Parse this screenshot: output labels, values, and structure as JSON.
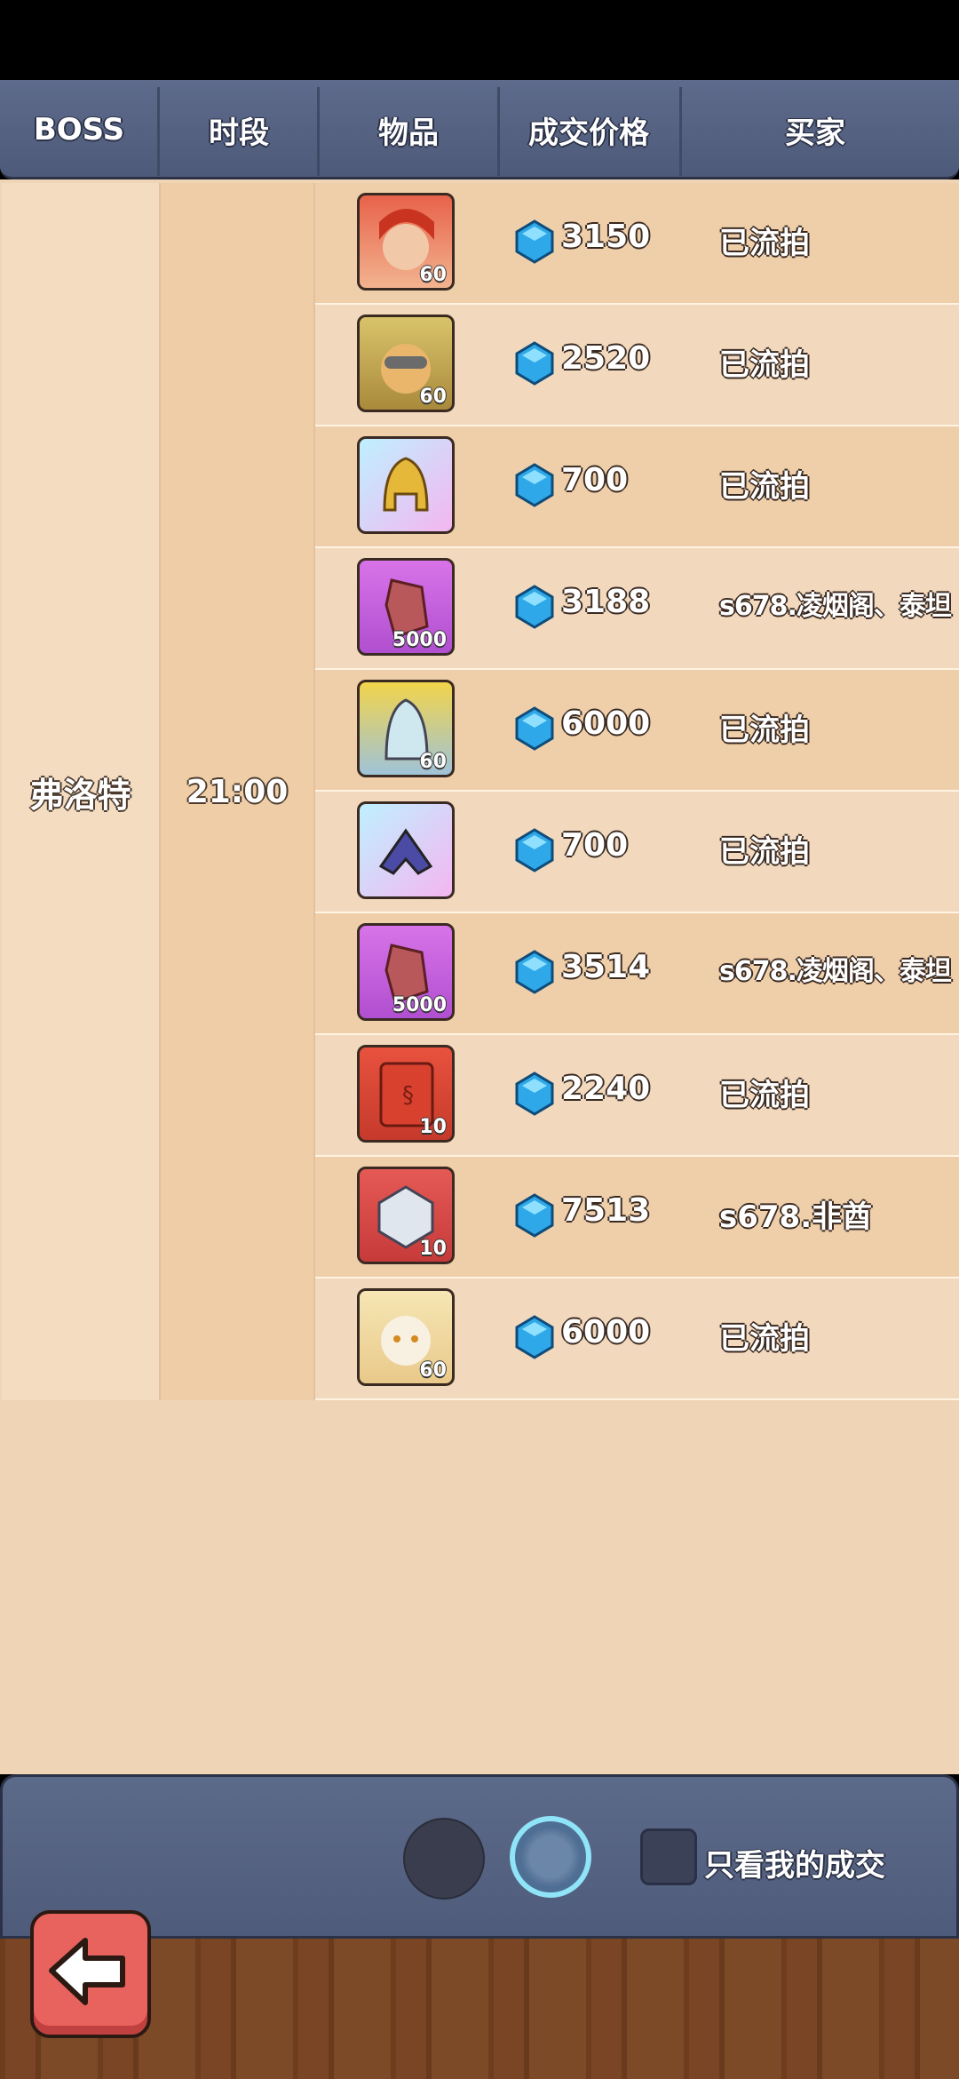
{
  "header": {
    "columns": [
      "BOSS",
      "时段",
      "物品",
      "成交价格",
      "买家"
    ]
  },
  "group": {
    "boss": "弗洛特",
    "time": "21:00"
  },
  "rows": [
    {
      "item": "red-haired-hero-card",
      "level": "60",
      "price": "3150",
      "buyer": "已流拍"
    },
    {
      "item": "goggles-hero-card",
      "level": "60",
      "price": "2520",
      "buyer": "已流拍"
    },
    {
      "item": "golden-helmet-equipment",
      "level": "",
      "price": "700",
      "buyer": "已流拍"
    },
    {
      "item": "crystal-ore",
      "level": "5000",
      "price": "3188",
      "buyer": "s678.凌烟阁、泰坦"
    },
    {
      "item": "armored-hero-card",
      "level": "60",
      "price": "6000",
      "buyer": "已流拍"
    },
    {
      "item": "blue-armor-equipment",
      "level": "",
      "price": "700",
      "buyer": "已流拍"
    },
    {
      "item": "crystal-ore",
      "level": "5000",
      "price": "3514",
      "buyer": "s678.凌烟阁、泰坦"
    },
    {
      "item": "red-book",
      "level": "10",
      "price": "2240",
      "buyer": "已流拍"
    },
    {
      "item": "crystal-badge",
      "level": "10",
      "price": "7513",
      "buyer": "s678.非酋"
    },
    {
      "item": "white-hero-card",
      "level": "60",
      "price": "6000",
      "buyer": "已流拍"
    }
  ],
  "footer": {
    "checkbox_label": "只看我的成交",
    "back_icon": "back-arrow-icon"
  },
  "colors": {
    "row_odd": "#efcfa9",
    "row_even": "#f2d9bd",
    "gem": "#2ea8e8",
    "back_button": "#e8635e"
  }
}
